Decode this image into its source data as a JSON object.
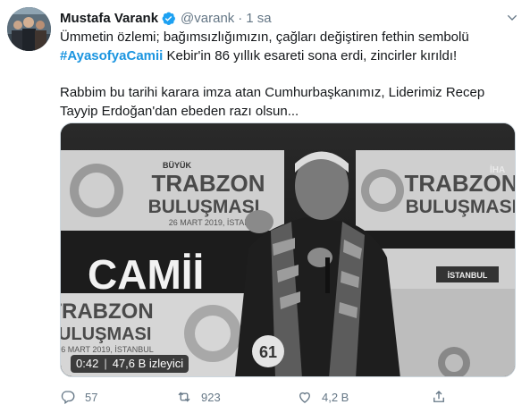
{
  "author": {
    "name": "Mustafa Varank",
    "handle": "@varank",
    "separator": "·",
    "time": "1 sa"
  },
  "tweet": {
    "line1": "Ümmetin özlemi; bağımsızlığımızın, çağları değiştiren fethin sembolü",
    "hashtag": "#AyasofyaCamii",
    "line2_rest": " Kebir'in 86 yıllık esareti sona erdi, zincirler kırıldı!",
    "line3": "Rabbim bu tarihi karara imza atan Cumhurbaşkanımız, Liderimiz Recep",
    "line4": "Tayyip Erdoğan'dan ebeden razı olsun..."
  },
  "media": {
    "banner_top": {
      "small": "BÜYÜK",
      "big1": "TRABZON",
      "big2": "BULUŞMASI",
      "date": "26 MART 2019, İSTANBUL"
    },
    "overlay_word": "CAMİİ",
    "watermark": "İHA",
    "banner_left": {
      "big1": "TRABZON",
      "big2": "BULUŞMASI",
      "date": "6 MART 2019, İSTANBUL"
    },
    "podium_sign": "İSTANBUL",
    "duration": "0:42",
    "views_sep": "|",
    "views": "47,6 B izleyici"
  },
  "actions": {
    "reply_count": "57",
    "retweet_count": "923",
    "like_count": "4,2 B"
  },
  "colors": {
    "link": "#1b95e0",
    "muted": "#657786",
    "verified": "#1da1f2"
  },
  "icons": [
    "verified-badge-icon",
    "chevron-down-icon",
    "reply-icon",
    "retweet-icon",
    "like-icon",
    "share-icon"
  ]
}
